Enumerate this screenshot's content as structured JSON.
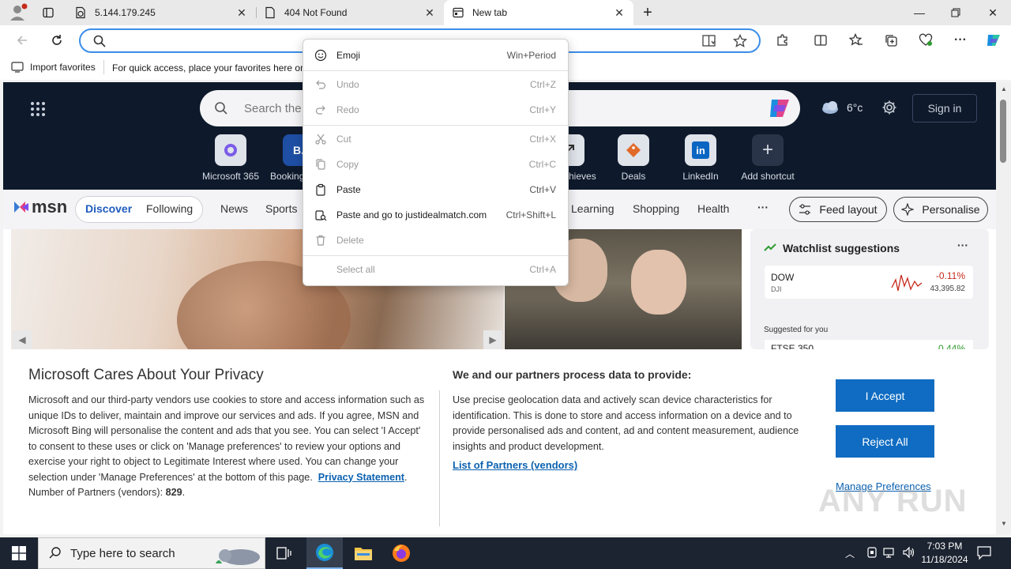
{
  "tabs": [
    {
      "label": "5.144.179.245"
    },
    {
      "label": "404 Not Found"
    },
    {
      "label": "New tab"
    }
  ],
  "favorites_bar": {
    "import_label": "Import favorites",
    "hint": "For quick access, place your favorites here on"
  },
  "msn": {
    "search_placeholder": "Search the",
    "weather_temp": "6°c",
    "sign_in": "Sign in",
    "shortcuts": [
      {
        "label": "Microsoft 365"
      },
      {
        "label": "Booking"
      },
      {
        "label": "hieves"
      },
      {
        "label": "Deals"
      },
      {
        "label": "LinkedIn"
      },
      {
        "label": "Add shortcut"
      }
    ],
    "logo": "msn",
    "nav": {
      "discover": "Discover",
      "following": "Following",
      "news": "News",
      "sports": "Sports",
      "learning": "Learning",
      "shopping": "Shopping",
      "health": "Health",
      "more": "···",
      "feed_layout": "Feed layout",
      "personalise": "Personalise"
    },
    "watchlist": {
      "title": "Watchlist suggestions",
      "stock_symbol": "DOW",
      "stock_sub": "DJI",
      "stock_change": "-0.11%",
      "stock_value": "43,395.82",
      "suggested": "Suggested for you",
      "stock2_symbol": "FTSE 350",
      "stock2_change": "0.44%"
    }
  },
  "context_menu": {
    "items": [
      {
        "label": "Emoji",
        "shortcut": "Win+Period"
      },
      {
        "label": "Undo",
        "shortcut": "Ctrl+Z"
      },
      {
        "label": "Redo",
        "shortcut": "Ctrl+Y"
      },
      {
        "label": "Cut",
        "shortcut": "Ctrl+X"
      },
      {
        "label": "Copy",
        "shortcut": "Ctrl+C"
      },
      {
        "label": "Paste",
        "shortcut": "Ctrl+V"
      },
      {
        "label": "Paste and go to justidealmatch.com",
        "shortcut": "Ctrl+Shift+L"
      },
      {
        "label": "Delete",
        "shortcut": ""
      },
      {
        "label": "Select all",
        "shortcut": "Ctrl+A"
      }
    ]
  },
  "privacy": {
    "title": "Microsoft Cares About Your Privacy",
    "body": "Microsoft and our third-party vendors use cookies to store and access information such as unique IDs to deliver, maintain and improve our services and ads. If you agree, MSN and Microsoft Bing will personalise the content and ads that you see. You can select 'I Accept' to consent to these uses or click on 'Manage preferences' to review your options and exercise your right to object to Legitimate Interest where used.  You can change your selection under 'Manage Preferences' at the bottom of this page.",
    "privacy_link": "Privacy Statement",
    "partners_label": "Number of Partners (vendors):",
    "partners_count": "829",
    "right_title": "We and our partners process data to provide:",
    "right_body": "Use precise geolocation data and actively scan device characteristics for identification. This is done to store and access information on a device and to provide personalised ads and content, ad and content measurement, audience insights and product development.",
    "partners_link": "List of Partners (vendors)",
    "accept": "I Accept",
    "reject": "Reject All",
    "manage": "Manage Preferences"
  },
  "taskbar": {
    "search_placeholder": "Type here to search",
    "time": "7:03 PM",
    "date": "11/18/2024"
  },
  "watermark": "ANY RUN",
  "colors": {
    "accent": "#0f6cc2",
    "address_focus": "#3c8ee8",
    "hero_bg": "#0e1a2c",
    "taskbar": "#1c2431"
  }
}
